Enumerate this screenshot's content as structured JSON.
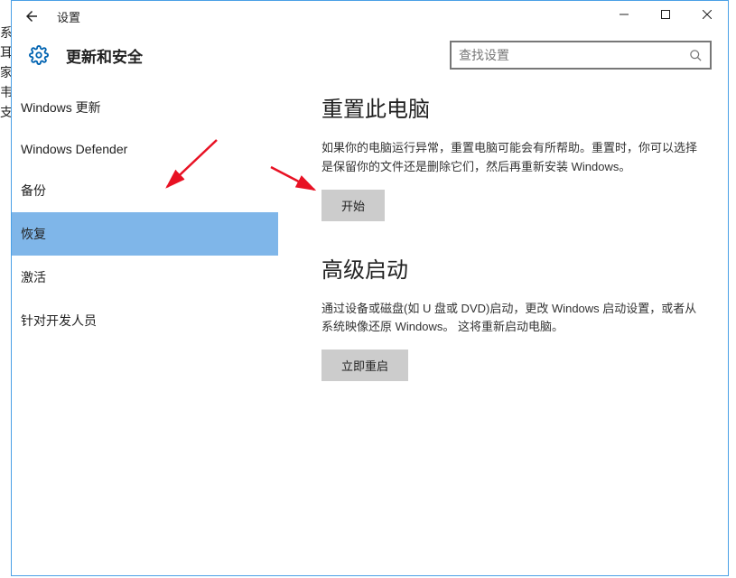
{
  "titlebar": {
    "title": "设置"
  },
  "header": {
    "title": "更新和安全",
    "search_placeholder": "查找设置"
  },
  "sidebar": {
    "items": [
      {
        "label": "Windows 更新",
        "selected": false
      },
      {
        "label": "Windows Defender",
        "selected": false
      },
      {
        "label": "备份",
        "selected": false
      },
      {
        "label": "恢复",
        "selected": true
      },
      {
        "label": "激活",
        "selected": false
      },
      {
        "label": "针对开发人员",
        "selected": false
      }
    ]
  },
  "main": {
    "sections": [
      {
        "heading": "重置此电脑",
        "body": "如果你的电脑运行异常，重置电脑可能会有所帮助。重置时，你可以选择是保留你的文件还是删除它们，然后再重新安装 Windows。",
        "button": "开始"
      },
      {
        "heading": "高级启动",
        "body": "通过设备或磁盘(如 U 盘或 DVD)启动，更改 Windows 启动设置，或者从系统映像还原 Windows。 这将重新启动电脑。",
        "button": "立即重启"
      }
    ]
  },
  "left_edge_chars": "系\n耳\n家\n韦\n支"
}
